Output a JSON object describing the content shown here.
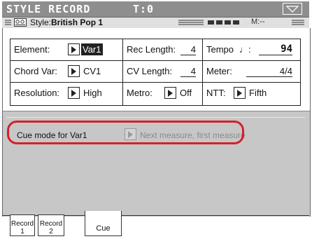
{
  "title_bar": {
    "title": "STYLE RECORD",
    "tempo_indicator": "T:0",
    "arrow_icon": "triangle-down-icon"
  },
  "style_bar": {
    "prefix": "Style:",
    "style_name": "British Pop 1",
    "measure": "M:--"
  },
  "params": {
    "element": {
      "label": "Element:",
      "value": "Var1"
    },
    "rec_length": {
      "label": "Rec Length:",
      "value": "4"
    },
    "tempo": {
      "label": "Tempo",
      "note": "♩:",
      "value": "94"
    },
    "chord_var": {
      "label": "Chord Var:",
      "value": "CV1"
    },
    "cv_length": {
      "label": "CV Length:",
      "value": "4"
    },
    "meter": {
      "label": "Meter:",
      "value": "4/4"
    },
    "resolution": {
      "label": "Resolution:",
      "value": "High"
    },
    "metro": {
      "label": "Metro:",
      "value": "Off"
    },
    "ntt": {
      "label": "NTT:",
      "value": "Fifth"
    }
  },
  "cue": {
    "label": "Cue mode for Var1",
    "value": "Next measure, first measure"
  },
  "tabs": [
    {
      "line1": "Record",
      "line2": "1"
    },
    {
      "line1": "Record",
      "line2": "2"
    },
    {
      "line1": "Cue",
      "line2": ""
    }
  ],
  "colors": {
    "title_bg": "#8e8e8e",
    "panel_bg": "#c7c7c7",
    "highlight": "#d6202a"
  }
}
